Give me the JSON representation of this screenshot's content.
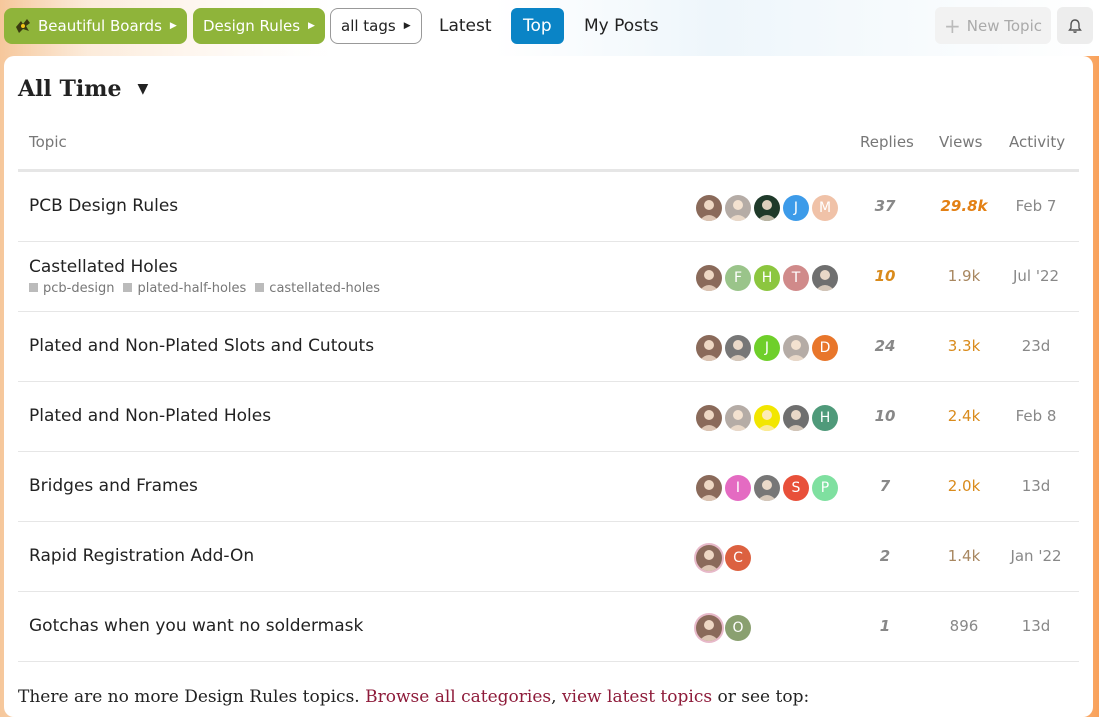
{
  "breadcrumbs": [
    {
      "label": "Beautiful Boards"
    },
    {
      "label": "Design Rules"
    },
    {
      "label": "all tags"
    }
  ],
  "nav": {
    "latest": "Latest",
    "top": "Top",
    "my_posts": "My Posts"
  },
  "header": {
    "new_topic": "New Topic"
  },
  "period": {
    "label": "All Time"
  },
  "columns": {
    "topic": "Topic",
    "replies": "Replies",
    "views": "Views",
    "activity": "Activity"
  },
  "topics": [
    {
      "title": "PCB Design Rules",
      "tags": [],
      "replies": "37",
      "views": "29.8k",
      "activity": "Feb 7",
      "avatars": [
        {
          "l": "",
          "c": "#8a6a5a"
        },
        {
          "l": "",
          "c": "#b5aca6"
        },
        {
          "l": "",
          "c": "#1f3a2a"
        },
        {
          "l": "J",
          "c": "#3d9be9"
        },
        {
          "l": "M",
          "c": "#f0c2a8"
        }
      ]
    },
    {
      "title": "Castellated Holes",
      "tags": [
        "pcb-design",
        "plated-half-holes",
        "castellated-holes"
      ],
      "replies": "10",
      "views": "1.9k",
      "activity": "Jul '22",
      "avatars": [
        {
          "l": "",
          "c": "#8a6a5a"
        },
        {
          "l": "F",
          "c": "#9ac48a"
        },
        {
          "l": "H",
          "c": "#8cc63f"
        },
        {
          "l": "T",
          "c": "#d08a8a"
        },
        {
          "l": "",
          "c": "#6f6f6f"
        }
      ]
    },
    {
      "title": "Plated and Non-Plated Slots and Cutouts",
      "tags": [],
      "replies": "24",
      "views": "3.3k",
      "activity": "23d",
      "avatars": [
        {
          "l": "",
          "c": "#8a6a5a"
        },
        {
          "l": "",
          "c": "#777"
        },
        {
          "l": "J",
          "c": "#6fcf2a"
        },
        {
          "l": "",
          "c": "#b5aca6"
        },
        {
          "l": "D",
          "c": "#e8762b"
        }
      ]
    },
    {
      "title": "Plated and Non-Plated Holes",
      "tags": [],
      "replies": "10",
      "views": "2.4k",
      "activity": "Feb 8",
      "avatars": [
        {
          "l": "",
          "c": "#8a6a5a"
        },
        {
          "l": "",
          "c": "#b5aca6"
        },
        {
          "l": "",
          "c": "#f2e600"
        },
        {
          "l": "",
          "c": "#6f6f6f"
        },
        {
          "l": "H",
          "c": "#4f9a7a"
        }
      ]
    },
    {
      "title": "Bridges and Frames",
      "tags": [],
      "replies": "7",
      "views": "2.0k",
      "activity": "13d",
      "avatars": [
        {
          "l": "",
          "c": "#8a6a5a"
        },
        {
          "l": "I",
          "c": "#e46bc2"
        },
        {
          "l": "",
          "c": "#777"
        },
        {
          "l": "S",
          "c": "#e8503a"
        },
        {
          "l": "P",
          "c": "#7fe0a0"
        }
      ]
    },
    {
      "title": "Rapid Registration Add-On",
      "tags": [],
      "replies": "2",
      "views": "1.4k",
      "activity": "Jan '22",
      "avatars": [
        {
          "l": "",
          "c": "#8a6a5a"
        },
        {
          "l": "C",
          "c": "#dc6140"
        }
      ]
    },
    {
      "title": "Gotchas when you want no soldermask",
      "tags": [],
      "replies": "1",
      "views": "896",
      "activity": "13d",
      "avatars": [
        {
          "l": "",
          "c": "#8a6a5a"
        },
        {
          "l": "O",
          "c": "#8aa070"
        }
      ]
    }
  ],
  "footer": {
    "prefix": "There are no more Design Rules topics.",
    "browse_link": "Browse all categories",
    "sep": ",",
    "latest_link": "view latest topics",
    "suffix": "or see top:"
  }
}
